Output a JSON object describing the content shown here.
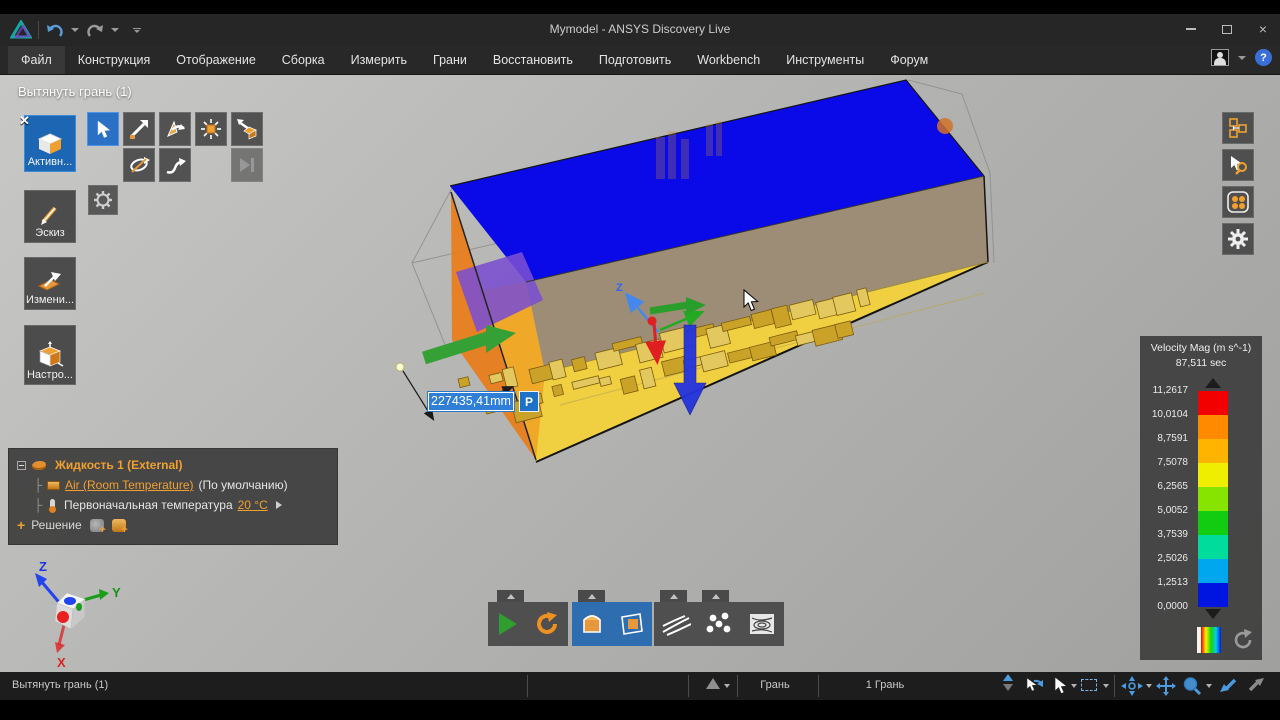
{
  "window": {
    "title": "Mymodel - ANSYS Discovery Live",
    "close_glyph": "×"
  },
  "menu": {
    "items": [
      "Файл",
      "Конструкция",
      "Отображение",
      "Сборка",
      "Измерить",
      "Грани",
      "Восстановить",
      "Подготовить",
      "Workbench",
      "Инструменты",
      "Форум"
    ],
    "help_glyph": "?"
  },
  "tool_panel": {
    "header": "Вытянуть грань (1)",
    "close_glyph": "✕",
    "active_label": "Активн...",
    "sketch_label": "Эскиз",
    "edit_label": "Измени...",
    "setup_label": "Настро..."
  },
  "viewport": {
    "dimension_value": "227435,41mm",
    "p_button": "P",
    "gizmo_axis_label": "Z"
  },
  "tree": {
    "root": "Жидкость 1 (External)",
    "branch_glyph": "├",
    "material_link": "Air (Room Temperature)",
    "material_default": "(По умолчанию)",
    "temperature_label": "Первоначальная температура",
    "temperature_value": "20 °C",
    "solution_plus": "+",
    "solution_label": "Решение"
  },
  "legend": {
    "title": "Velocity Mag (m s^-1)",
    "time": "87,511 sec",
    "tick_labels": [
      "11,2617",
      "10,0104",
      "8,7591",
      "7,5078",
      "6,2565",
      "5,0052",
      "3,7539",
      "2,5026",
      "1,2513",
      "0,0000"
    ],
    "band_colors": [
      "#f20000",
      "#ff8a00",
      "#ffb400",
      "#f0ee00",
      "#86e400",
      "#12cc12",
      "#00dc9b",
      "#00a6ee",
      "#0016e0"
    ]
  },
  "status_bar": {
    "left": "Вытянуть грань (1)",
    "selection_mode": "Грань",
    "selection_count": "1 Грань"
  },
  "triad": {
    "x": "X",
    "y": "Y",
    "z": "Z"
  },
  "colors": {
    "accent_blue": "#2a74c8",
    "accent_orange": "#e8973a",
    "play_green": "#2f9e2f",
    "reset_orange": "#f09020",
    "face_blue": "#0a0ae8",
    "face_yellow": "#f0d040",
    "face_tan": "#9d8d76",
    "face_orange": "#e87d1e",
    "face_purple": "#7a4fd0"
  }
}
